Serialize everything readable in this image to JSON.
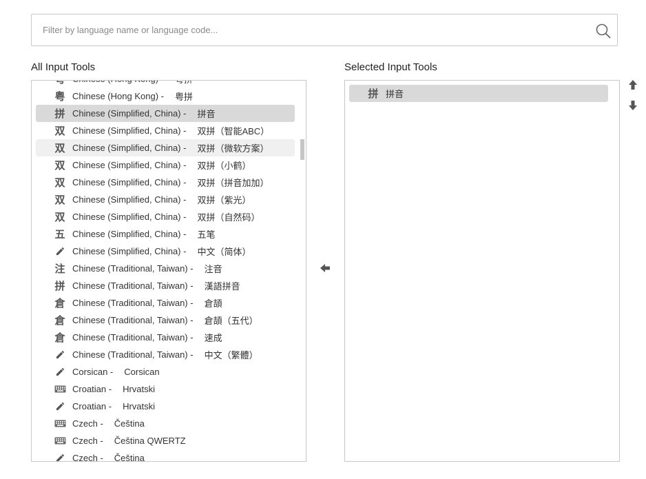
{
  "search": {
    "placeholder": "Filter by language name or language code...",
    "value": ""
  },
  "all_tools": {
    "title": "All Input Tools",
    "items": [
      {
        "icon": "yue-glyph-icon",
        "glyph": "粤",
        "name": "Chinese (Hong Kong) -",
        "native": "粤拼"
      },
      {
        "icon": "yue-glyph-icon",
        "glyph": "粤",
        "name": "Chinese (Hong Kong) -",
        "native": "粤拼"
      },
      {
        "icon": "pin-glyph-icon",
        "glyph": "拼",
        "name": "Chinese (Simplified, China) -",
        "native": "拼音"
      },
      {
        "icon": "shuang-glyph-icon",
        "glyph": "双",
        "name": "Chinese (Simplified, China) -",
        "native": "双拼（智能ABC）"
      },
      {
        "icon": "shuang-glyph-icon",
        "glyph": "双",
        "name": "Chinese (Simplified, China) -",
        "native": "双拼（微软方案）"
      },
      {
        "icon": "shuang-glyph-icon",
        "glyph": "双",
        "name": "Chinese (Simplified, China) -",
        "native": "双拼（小鹤）"
      },
      {
        "icon": "shuang-glyph-icon",
        "glyph": "双",
        "name": "Chinese (Simplified, China) -",
        "native": "双拼（拼音加加）"
      },
      {
        "icon": "shuang-glyph-icon",
        "glyph": "双",
        "name": "Chinese (Simplified, China) -",
        "native": "双拼（紫光）"
      },
      {
        "icon": "shuang-glyph-icon",
        "glyph": "双",
        "name": "Chinese (Simplified, China) -",
        "native": "双拼（自然码）"
      },
      {
        "icon": "wu-glyph-icon",
        "glyph": "五",
        "name": "Chinese (Simplified, China) -",
        "native": "五笔"
      },
      {
        "icon": "pencil-icon",
        "glyph": "",
        "name": "Chinese (Simplified, China) -",
        "native": "中文（简体）"
      },
      {
        "icon": "zhu-glyph-icon",
        "glyph": "注",
        "name": "Chinese (Traditional, Taiwan) -",
        "native": "注音"
      },
      {
        "icon": "pin-glyph-icon",
        "glyph": "拼",
        "name": "Chinese (Traditional, Taiwan) -",
        "native": "漢語拼音"
      },
      {
        "icon": "cang-glyph-icon",
        "glyph": "倉",
        "name": "Chinese (Traditional, Taiwan) -",
        "native": "倉頡"
      },
      {
        "icon": "cang-glyph-icon",
        "glyph": "倉",
        "name": "Chinese (Traditional, Taiwan) -",
        "native": "倉頡（五代）"
      },
      {
        "icon": "cang-glyph-icon",
        "glyph": "倉",
        "name": "Chinese (Traditional, Taiwan) -",
        "native": "速成"
      },
      {
        "icon": "pencil-icon",
        "glyph": "",
        "name": "Chinese (Traditional, Taiwan) -",
        "native": "中文（繁體）"
      },
      {
        "icon": "pencil-icon",
        "glyph": "",
        "name": "Corsican -",
        "native": "Corsican"
      },
      {
        "icon": "keyboard-icon",
        "glyph": "",
        "name": "Croatian -",
        "native": "Hrvatski"
      },
      {
        "icon": "pencil-icon",
        "glyph": "",
        "name": "Croatian -",
        "native": "Hrvatski"
      },
      {
        "icon": "keyboard-icon",
        "glyph": "",
        "name": "Czech -",
        "native": "Čeština"
      },
      {
        "icon": "keyboard-icon",
        "glyph": "",
        "name": "Czech -",
        "native": "Čeština QWERTZ"
      },
      {
        "icon": "pencil-icon",
        "glyph": "",
        "name": "Czech -",
        "native": "Čeština"
      }
    ]
  },
  "selected_tools": {
    "title": "Selected Input Tools",
    "items": [
      {
        "icon": "pin-glyph-icon",
        "glyph": "拼",
        "native": "拼音"
      }
    ]
  },
  "colors": {
    "selected_row": "#d9d9d9",
    "hover_row": "#f0f0f0",
    "border": "#c8c8c8",
    "icon": "#555555"
  }
}
